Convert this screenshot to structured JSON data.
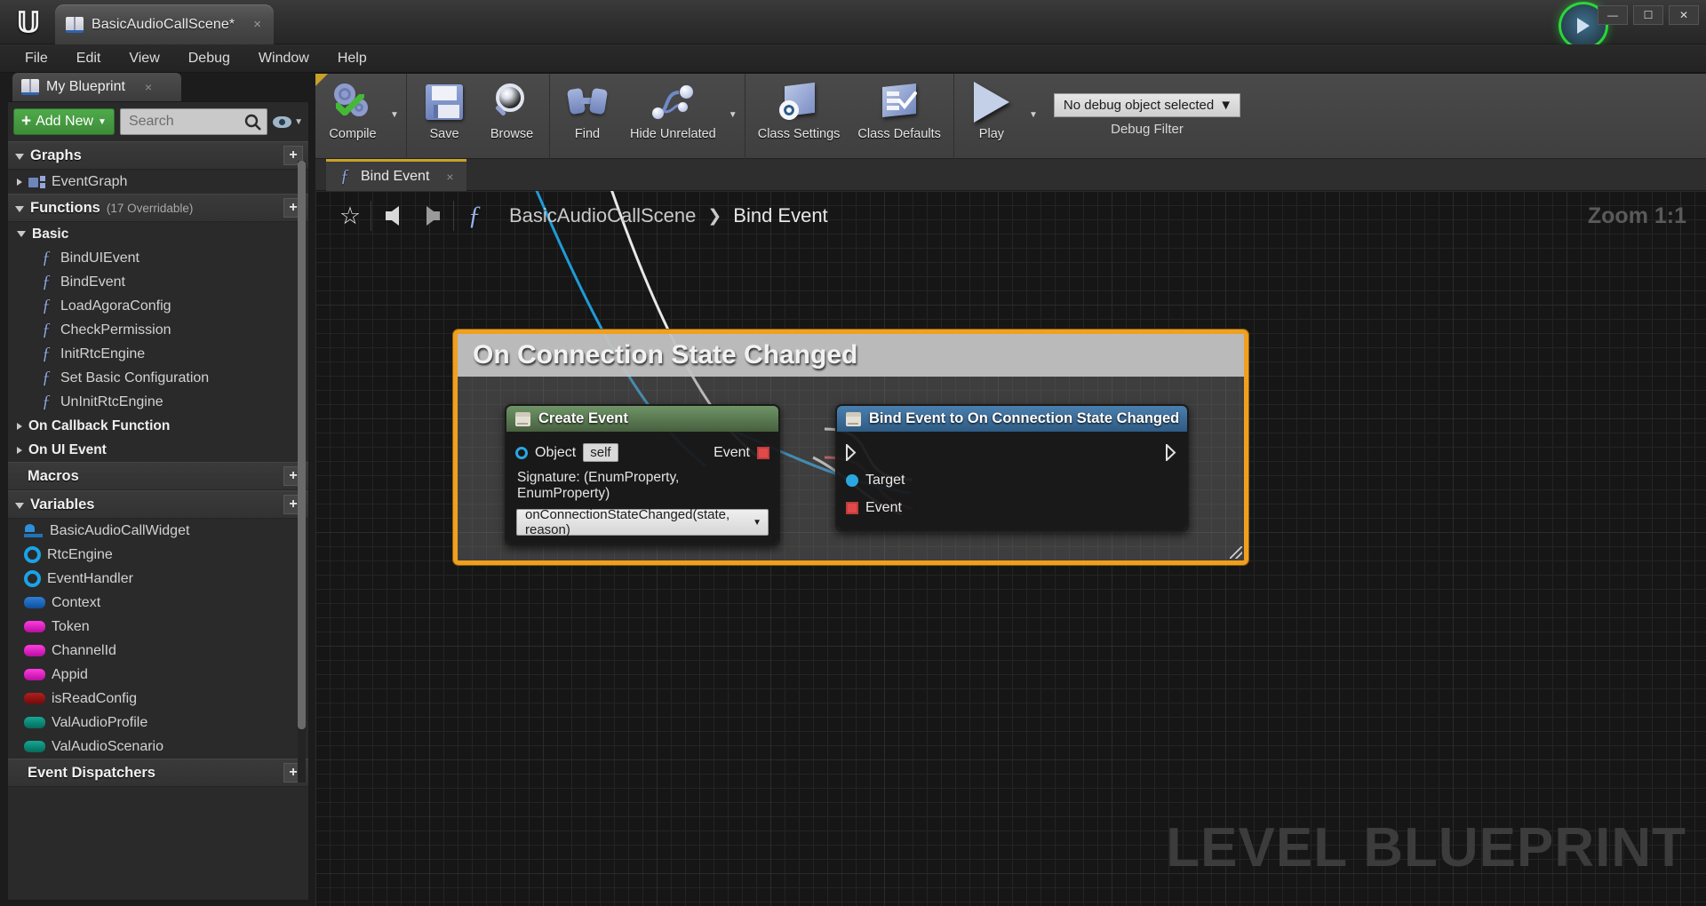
{
  "titlebar": {
    "logo": "unreal-logo",
    "tab_label": "BasicAudioCallScene*",
    "tab_close": "×",
    "minimize": "—",
    "maximize": "☐",
    "close": "✕"
  },
  "menubar": {
    "items": [
      "File",
      "Edit",
      "View",
      "Debug",
      "Window",
      "Help"
    ]
  },
  "toolbar": {
    "compile": "Compile",
    "save": "Save",
    "browse": "Browse",
    "find": "Find",
    "hide_unrelated": "Hide Unrelated",
    "class_settings": "Class Settings",
    "class_defaults": "Class Defaults",
    "play": "Play",
    "debug_object": "No debug object selected",
    "debug_filter_label": "Debug Filter",
    "caret": "▼"
  },
  "my_blueprint": {
    "tab_label": "My Blueprint",
    "tab_close": "×",
    "add_new": "Add New",
    "add_new_plus": "+",
    "search_placeholder": "Search",
    "sections": {
      "graphs": {
        "title": "Graphs",
        "add": "+"
      },
      "functions": {
        "title": "Functions",
        "subtitle": "(17 Overridable)",
        "add": "+"
      },
      "macros": {
        "title": "Macros",
        "add": "+"
      },
      "variables": {
        "title": "Variables",
        "add": "+"
      },
      "event_dispatchers": {
        "title": "Event Dispatchers",
        "add": "+"
      }
    },
    "graphs_items": [
      {
        "label": "EventGraph"
      }
    ],
    "function_categories": [
      {
        "label": "Basic",
        "expanded": true
      },
      {
        "label": "On Callback Function",
        "expanded": false
      },
      {
        "label": "On UI Event",
        "expanded": false
      }
    ],
    "functions": [
      {
        "label": "BindUIEvent"
      },
      {
        "label": "BindEvent"
      },
      {
        "label": "LoadAgoraConfig"
      },
      {
        "label": "CheckPermission"
      },
      {
        "label": "InitRtcEngine"
      },
      {
        "label": "Set Basic Configuration"
      },
      {
        "label": "UnInitRtcEngine"
      }
    ],
    "variables": [
      {
        "label": "BasicAudioCallWidget",
        "icon": "widget",
        "color": "#2f8fd8"
      },
      {
        "label": "RtcEngine",
        "icon": "ring",
        "color": "#1aa3e8"
      },
      {
        "label": "EventHandler",
        "icon": "ring",
        "color": "#1aa3e8"
      },
      {
        "label": "Context",
        "icon": "pill",
        "color": "#1d63b5"
      },
      {
        "label": "Token",
        "icon": "pill",
        "color": "#e116c8"
      },
      {
        "label": "ChannelId",
        "icon": "pill",
        "color": "#e116c8"
      },
      {
        "label": "Appid",
        "icon": "pill",
        "color": "#e116c8"
      },
      {
        "label": "isReadConfig",
        "icon": "pill",
        "color": "#921717"
      },
      {
        "label": "ValAudioProfile",
        "icon": "pill",
        "color": "#0f8a78"
      },
      {
        "label": "ValAudioScenario",
        "icon": "pill",
        "color": "#0f8a78"
      }
    ]
  },
  "graph": {
    "tab_label": "Bind Event",
    "tab_close": "×",
    "breadcrumb_root": "BasicAudioCallScene",
    "breadcrumb_sep": "❯",
    "breadcrumb_current": "Bind Event",
    "zoom": "Zoom 1:1",
    "watermark": "LEVEL BLUEPRINT",
    "comment": {
      "title": "On Connection State Changed",
      "border_color": "#f0a01e"
    },
    "nodes": [
      {
        "id": "create-event",
        "title": "Create Event",
        "color": "#47603f",
        "pins_left": [
          {
            "label": "Object",
            "type": "object",
            "value": "self"
          }
        ],
        "pins_right": [
          {
            "label": "Event",
            "type": "delegate"
          }
        ],
        "signature": "Signature: (EnumProperty, EnumProperty)",
        "dropdown": "onConnectionStateChanged(state, reason)",
        "dropdown_caret": "▼"
      },
      {
        "id": "bind-event",
        "title": "Bind Event to On Connection State Changed",
        "color": "#2e5b83",
        "pins_left": [
          {
            "label": "",
            "type": "exec"
          },
          {
            "label": "Target",
            "type": "object"
          },
          {
            "label": "Event",
            "type": "delegate"
          }
        ],
        "pins_right": [
          {
            "label": "",
            "type": "exec"
          }
        ]
      }
    ]
  }
}
